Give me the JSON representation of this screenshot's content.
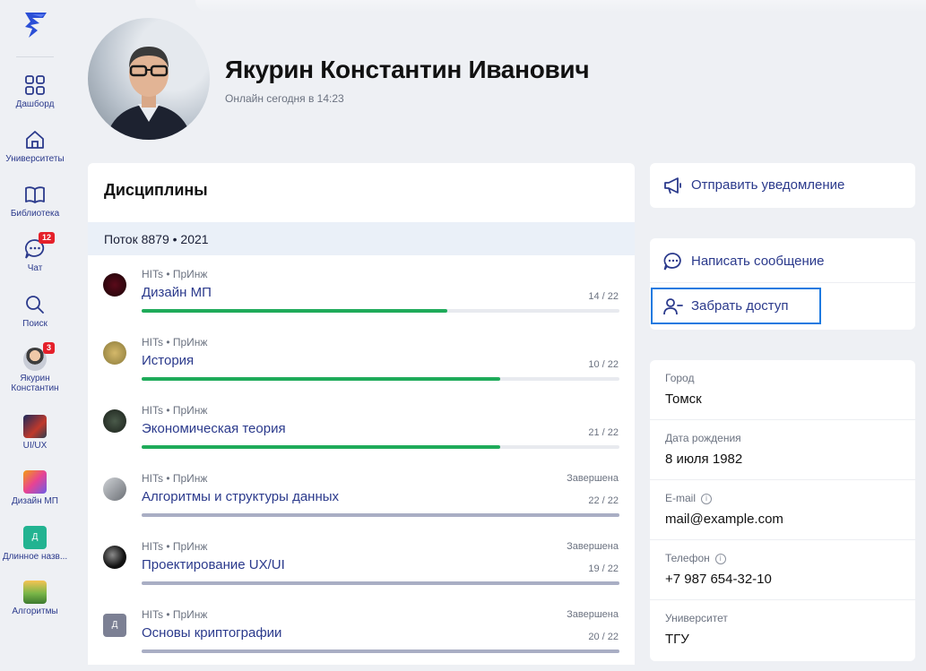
{
  "sidebar": {
    "items": [
      {
        "label": "Дашборд",
        "icon": "dashboard-icon"
      },
      {
        "label": "Университеты",
        "icon": "university-icon"
      },
      {
        "label": "Библиотека",
        "icon": "book-icon"
      },
      {
        "label": "Чат",
        "icon": "chat-icon",
        "badge": "12"
      },
      {
        "label": "Поиск",
        "icon": "search-icon"
      },
      {
        "label": "Якурин Константин",
        "icon": "avatar",
        "badge": "3"
      },
      {
        "label": "UI/UX",
        "icon": "course-thumb"
      },
      {
        "label": "Дизайн МП",
        "icon": "course-thumb"
      },
      {
        "label": "Длинное назв...",
        "icon": "letter-thumb",
        "letter": "Д"
      },
      {
        "label": "Алгоритмы",
        "icon": "course-thumb"
      }
    ]
  },
  "profile": {
    "name": "Якурин Константин Иванович",
    "status": "Онлайн сегодня в 14:23"
  },
  "disciplines": {
    "title": "Дисциплины",
    "stream": "Поток 8879 • 2021",
    "courses": [
      {
        "sub": "HITs • ПрИнж",
        "name": "Дизайн МП",
        "done": "",
        "count": "14 / 22",
        "progress": 0.64,
        "color": "#1fab5a"
      },
      {
        "sub": "HITs • ПрИнж",
        "name": "История",
        "done": "",
        "count": "10 / 22",
        "progress": 0.75,
        "color": "#1fab5a"
      },
      {
        "sub": "HITs • ПрИнж",
        "name": "Экономическая теория",
        "done": "",
        "count": "21 / 22",
        "progress": 0.75,
        "color": "#1fab5a"
      },
      {
        "sub": "HITs • ПрИнж",
        "name": "Алгоритмы и структуры данных",
        "done": "Завершена",
        "count": "22 / 22",
        "progress": 1.0,
        "color": "#a9aec4"
      },
      {
        "sub": "HITs • ПрИнж",
        "name": "Проектирование UX/UI",
        "done": "Завершена",
        "count": "19 / 22",
        "progress": 1.0,
        "color": "#a9aec4"
      },
      {
        "sub": "HITs • ПрИнж",
        "name": "Основы криптографии",
        "done": "Завершена",
        "count": "20 / 22",
        "progress": 1.0,
        "color": "#a9aec4",
        "letter": "Д"
      }
    ]
  },
  "actions": {
    "notify": "Отправить уведомление",
    "message": "Написать сообщение",
    "revoke": "Забрать доступ"
  },
  "info": {
    "city": {
      "key": "Город",
      "value": "Томск"
    },
    "birth": {
      "key": "Дата рождения",
      "value": "8 июля 1982"
    },
    "email": {
      "key": "E-mail",
      "value": "mail@example.com"
    },
    "phone": {
      "key": "Телефон",
      "value": "+7 987 654-32-10"
    },
    "university": {
      "key": "Университет",
      "value": "ТГУ"
    }
  },
  "colors": {
    "accent": "#2b3a8c",
    "green": "#1fab5a",
    "badge": "#e5202a",
    "focus": "#1e7ae0"
  }
}
